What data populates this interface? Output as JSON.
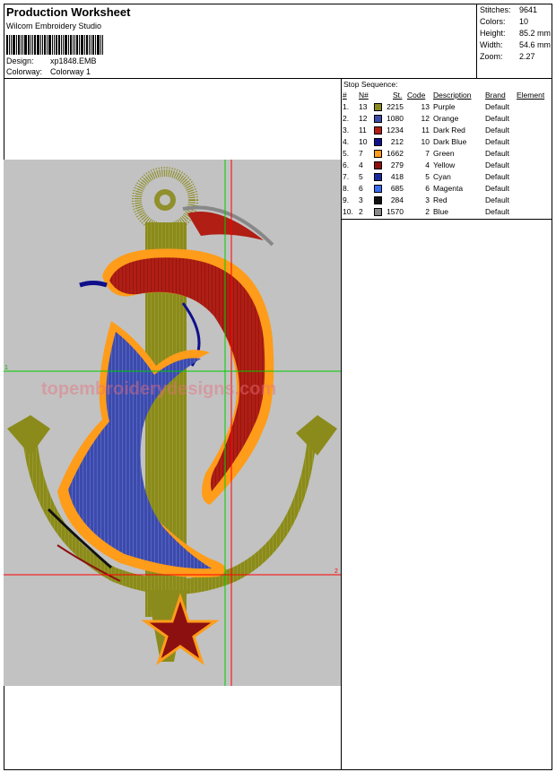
{
  "header": {
    "title": "Production Worksheet",
    "company": "Wilcom Embroidery Studio",
    "design_label": "Design:",
    "design_value": "xp1848.EMB",
    "colorway_label": "Colorway:",
    "colorway_value": "Colorway 1"
  },
  "stats": {
    "stitches_label": "Stitches:",
    "stitches_value": "9641",
    "colors_label": "Colors:",
    "colors_value": "10",
    "height_label": "Height:",
    "height_value": "85.2 mm",
    "width_label": "Width:",
    "width_value": "54.6 mm",
    "zoom_label": "Zoom:",
    "zoom_value": "2.27"
  },
  "sequence": {
    "title": "Stop Sequence:",
    "headers": [
      "#",
      "N#",
      "St.",
      "Code",
      "Description",
      "Brand",
      "Element"
    ],
    "rows": [
      {
        "num": "1.",
        "n": "13",
        "color": "#8b8b1c",
        "st": "2215",
        "code": "13",
        "desc": "Purple",
        "brand": "Default"
      },
      {
        "num": "2.",
        "n": "12",
        "color": "#3e4aa8",
        "st": "1080",
        "code": "12",
        "desc": "Orange",
        "brand": "Default"
      },
      {
        "num": "3.",
        "n": "11",
        "color": "#b01e14",
        "st": "1234",
        "code": "11",
        "desc": "Dark Red",
        "brand": "Default"
      },
      {
        "num": "4.",
        "n": "10",
        "color": "#10108c",
        "st": "212",
        "code": "10",
        "desc": "Dark Blue",
        "brand": "Default"
      },
      {
        "num": "5.",
        "n": "7",
        "color": "#ff9c1a",
        "st": "1662",
        "code": "7",
        "desc": "Green",
        "brand": "Default"
      },
      {
        "num": "6.",
        "n": "4",
        "color": "#8c1010",
        "st": "279",
        "code": "4",
        "desc": "Yellow",
        "brand": "Default"
      },
      {
        "num": "7.",
        "n": "5",
        "color": "#1a2a9c",
        "st": "418",
        "code": "5",
        "desc": "Cyan",
        "brand": "Default"
      },
      {
        "num": "8.",
        "n": "6",
        "color": "#3a6cf0",
        "st": "685",
        "code": "6",
        "desc": "Magenta",
        "brand": "Default"
      },
      {
        "num": "9.",
        "n": "3",
        "color": "#111111",
        "st": "284",
        "code": "3",
        "desc": "Red",
        "brand": "Default"
      },
      {
        "num": "10.",
        "n": "2",
        "color": "#888888",
        "st": "1570",
        "code": "2",
        "desc": "Blue",
        "brand": "Default"
      }
    ]
  },
  "design": {
    "marker_1": "1",
    "marker_2": "2",
    "watermark": "topembroiderydesigns.com",
    "background": "#c2c2c2"
  }
}
